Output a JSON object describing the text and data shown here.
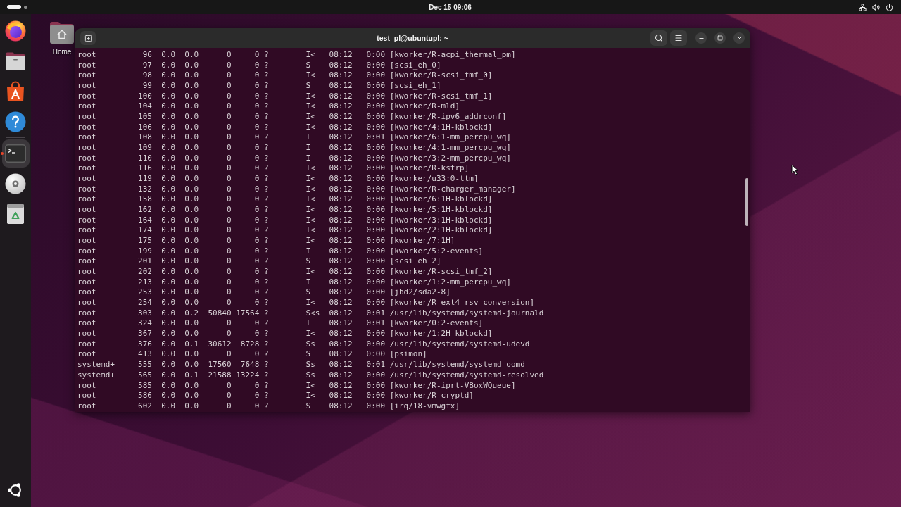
{
  "top_bar": {
    "workspaces": [
      {
        "selected": true
      },
      {
        "selected": false
      }
    ],
    "clock": "Dec 15 09:06"
  },
  "dock": {
    "groups": [
      {
        "items": [
          {
            "kind": "browser",
            "running": false,
            "focused": false
          },
          {
            "kind": "files",
            "running": false,
            "focused": false
          },
          {
            "kind": "app-store",
            "running": false,
            "focused": false
          },
          {
            "kind": "help",
            "running": false,
            "focused": false
          }
        ]
      },
      {
        "items": [
          {
            "kind": "terminal",
            "running": true,
            "focused": true
          },
          {
            "kind": "disc",
            "running": false,
            "focused": false
          },
          {
            "kind": "trash",
            "running": false,
            "focused": false
          }
        ]
      }
    ]
  },
  "desktop": {
    "icons": [
      {
        "label": "Home"
      }
    ]
  },
  "terminal": {
    "title": "test_pl@ubuntupl: ~",
    "lines": [
      "root          96  0.0  0.0      0     0 ?        I<   08:12   0:00 [kworker/R-acpi_thermal_pm]",
      "root          97  0.0  0.0      0     0 ?        S    08:12   0:00 [scsi_eh_0]",
      "root          98  0.0  0.0      0     0 ?        I<   08:12   0:00 [kworker/R-scsi_tmf_0]",
      "root          99  0.0  0.0      0     0 ?        S    08:12   0:00 [scsi_eh_1]",
      "root         100  0.0  0.0      0     0 ?        I<   08:12   0:00 [kworker/R-scsi_tmf_1]",
      "root         104  0.0  0.0      0     0 ?        I<   08:12   0:00 [kworker/R-mld]",
      "root         105  0.0  0.0      0     0 ?        I<   08:12   0:00 [kworker/R-ipv6_addrconf]",
      "root         106  0.0  0.0      0     0 ?        I<   08:12   0:00 [kworker/4:1H-kblockd]",
      "root         108  0.0  0.0      0     0 ?        I    08:12   0:01 [kworker/6:1-mm_percpu_wq]",
      "root         109  0.0  0.0      0     0 ?        I    08:12   0:00 [kworker/4:1-mm_percpu_wq]",
      "root         110  0.0  0.0      0     0 ?        I    08:12   0:00 [kworker/3:2-mm_percpu_wq]",
      "root         116  0.0  0.0      0     0 ?        I<   08:12   0:00 [kworker/R-kstrp]",
      "root         119  0.0  0.0      0     0 ?        I<   08:12   0:00 [kworker/u33:0-ttm]",
      "root         132  0.0  0.0      0     0 ?        I<   08:12   0:00 [kworker/R-charger_manager]",
      "root         158  0.0  0.0      0     0 ?        I<   08:12   0:00 [kworker/6:1H-kblockd]",
      "root         162  0.0  0.0      0     0 ?        I<   08:12   0:00 [kworker/5:1H-kblockd]",
      "root         164  0.0  0.0      0     0 ?        I<   08:12   0:00 [kworker/3:1H-kblockd]",
      "root         174  0.0  0.0      0     0 ?        I<   08:12   0:00 [kworker/2:1H-kblockd]",
      "root         175  0.0  0.0      0     0 ?        I<   08:12   0:00 [kworker/7:1H]",
      "root         199  0.0  0.0      0     0 ?        I    08:12   0:00 [kworker/5:2-events]",
      "root         201  0.0  0.0      0     0 ?        S    08:12   0:00 [scsi_eh_2]",
      "root         202  0.0  0.0      0     0 ?        I<   08:12   0:00 [kworker/R-scsi_tmf_2]",
      "root         213  0.0  0.0      0     0 ?        I    08:12   0:00 [kworker/1:2-mm_percpu_wq]",
      "root         253  0.0  0.0      0     0 ?        S    08:12   0:00 [jbd2/sda2-8]",
      "root         254  0.0  0.0      0     0 ?        I<   08:12   0:00 [kworker/R-ext4-rsv-conversion]",
      "root         303  0.0  0.2  50840 17564 ?        S<s  08:12   0:01 /usr/lib/systemd/systemd-journald",
      "root         324  0.0  0.0      0     0 ?        I    08:12   0:01 [kworker/0:2-events]",
      "root         367  0.0  0.0      0     0 ?        I<   08:12   0:00 [kworker/1:2H-kblockd]",
      "root         376  0.0  0.1  30612  8728 ?        Ss   08:12   0:00 /usr/lib/systemd/systemd-udevd",
      "root         413  0.0  0.0      0     0 ?        S    08:12   0:00 [psimon]",
      "systemd+     555  0.0  0.0  17560  7648 ?        Ss   08:12   0:01 /usr/lib/systemd/systemd-oomd",
      "systemd+     565  0.0  0.1  21588 13224 ?        Ss   08:12   0:00 /usr/lib/systemd/systemd-resolved",
      "root         585  0.0  0.0      0     0 ?        I<   08:12   0:00 [kworker/R-iprt-VBoxWQueue]",
      "root         586  0.0  0.0      0     0 ?        I<   08:12   0:00 [kworker/R-cryptd]",
      "root         602  0.0  0.0      0     0 ?        S    08:12   0:00 [irq/18-vmwgfx]"
    ]
  }
}
